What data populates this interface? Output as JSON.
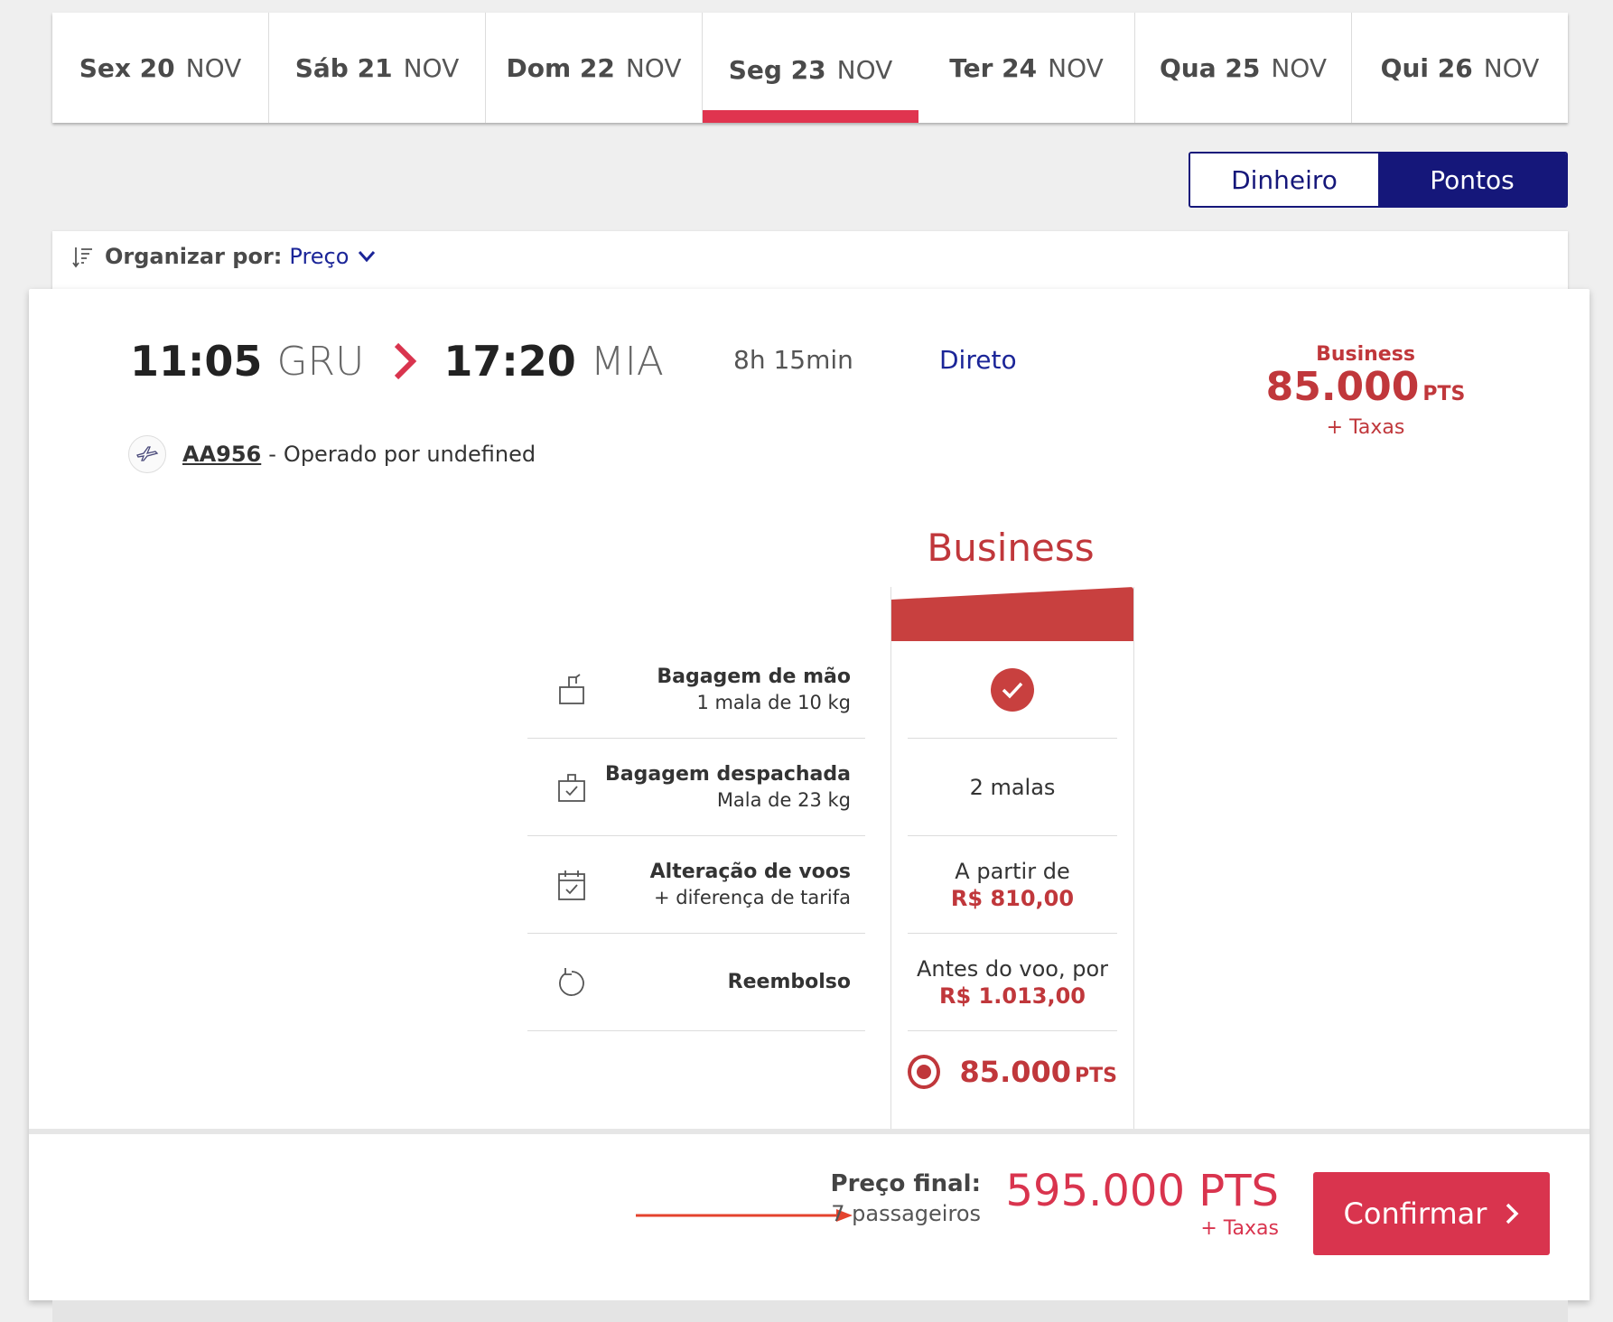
{
  "date_tabs": [
    {
      "day": "Sex 20",
      "month": "NOV"
    },
    {
      "day": "Sáb 21",
      "month": "NOV"
    },
    {
      "day": "Dom 22",
      "month": "NOV"
    },
    {
      "day": "Seg 23",
      "month": "NOV"
    },
    {
      "day": "Ter 24",
      "month": "NOV"
    },
    {
      "day": "Qua 25",
      "month": "NOV"
    },
    {
      "day": "Qui 26",
      "month": "NOV"
    }
  ],
  "active_tab_index": 3,
  "currency_toggle": {
    "cash_label": "Dinheiro",
    "points_label": "Pontos",
    "selected": "Pontos"
  },
  "sort": {
    "label": "Organizar por:",
    "value": "Preço"
  },
  "flight": {
    "departure_time": "11:05",
    "departure_airport": "GRU",
    "arrival_time": "17:20",
    "arrival_airport": "MIA",
    "duration": "8h 15min",
    "stops": "Direto",
    "summary_cabin": "Business",
    "summary_points": "85.000",
    "summary_unit": "PTS",
    "summary_taxes": "+ Taxas",
    "flight_number": "AA956",
    "separator": "-",
    "operated_by": "Operado por undefined"
  },
  "fare": {
    "title": "Business",
    "features": [
      {
        "title": "Bagagem de mão",
        "sub": "1 mala de 10 kg",
        "icon": "carry-on-bag-icon"
      },
      {
        "title": "Bagagem despachada",
        "sub": "Mala de 23 kg",
        "icon": "checked-bag-icon"
      },
      {
        "title": "Alteração de voos",
        "sub": "+ diferença de tarifa",
        "icon": "calendar-icon"
      },
      {
        "title": "Reembolso",
        "sub": "",
        "icon": "refund-icon"
      }
    ],
    "cells": {
      "checked_bag": "2 malas",
      "change_prefix": "A partir de",
      "change_price": "R$ 810,00",
      "refund_prefix": "Antes do voo, por",
      "refund_price": "R$ 1.013,00"
    },
    "select_points": "85.000",
    "select_unit": "PTS"
  },
  "footer": {
    "final_label": "Preço final:",
    "passengers": "7 passageiros",
    "total": "595.000 PTS",
    "taxes": "+ Taxas",
    "confirm_label": "Confirmar"
  },
  "colors": {
    "brand_red": "#d9344e",
    "fare_red": "#c0373b",
    "navy": "#15177a",
    "link_blue": "#1b2598"
  }
}
